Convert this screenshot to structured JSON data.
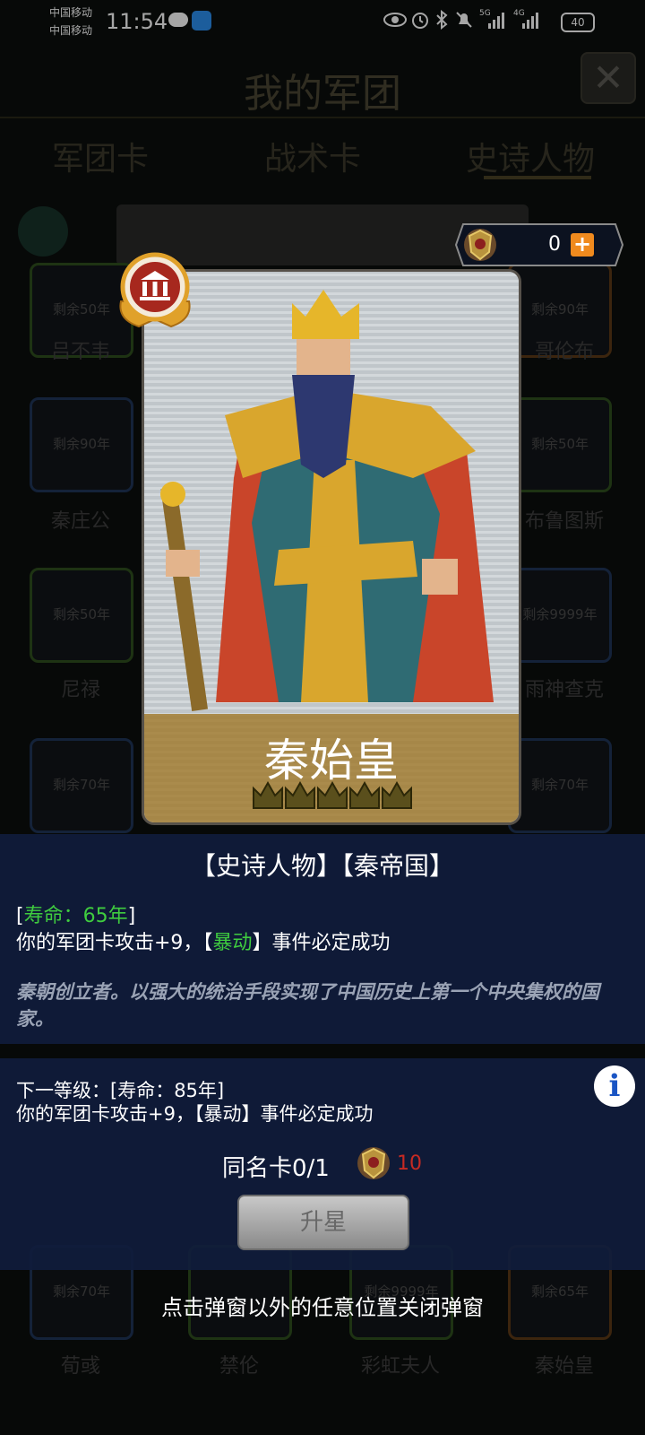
{
  "status_bar": {
    "carrier1": "中国移动",
    "carrier2": "中国移动",
    "time": "11:54",
    "signal_5g": "5G",
    "signal_4g": "4G",
    "battery": "40"
  },
  "background": {
    "title": "我的军团",
    "tabs": [
      "军团卡",
      "战术卡",
      "史诗人物"
    ],
    "cards": [
      {
        "remain": "剩余50年",
        "name": "吕不韦",
        "color": "green"
      },
      {
        "remain": "剩余90年",
        "name": "哥伦布",
        "color": "orange"
      },
      {
        "remain": "剩余90年",
        "name": "秦庄公",
        "color": "blue"
      },
      {
        "remain": "剩余50年",
        "name": "布鲁图斯",
        "color": "green"
      },
      {
        "remain": "剩余50年",
        "name": "尼禄",
        "color": "green"
      },
      {
        "remain": "剩余9999年",
        "name": "雨神查克",
        "color": "blue"
      },
      {
        "remain": "剩余70年",
        "name": "",
        "color": "blue"
      },
      {
        "remain": "剩余70年",
        "name": "",
        "color": "blue"
      },
      {
        "remain": "剩余70年",
        "name": "荀彧",
        "color": "blue"
      },
      {
        "remain": "",
        "name": "禁伦",
        "color": "green"
      },
      {
        "remain": "剩余9999年",
        "name": "彩虹夫人",
        "color": "green"
      },
      {
        "remain": "剩余65年",
        "name": "秦始皇",
        "color": "orange"
      }
    ]
  },
  "currency": {
    "value": "0",
    "plus": "+"
  },
  "hero_card": {
    "name": "秦始皇"
  },
  "info": {
    "tags": "【史诗人物】【秦帝国】",
    "life_open": "[",
    "life_text": "寿命：65年",
    "life_close": "]",
    "effect_pre": "你的军团卡攻击+9，【",
    "effect_key": "暴动",
    "effect_post": "】事件必定成功",
    "lore": "秦朝创立者。以强大的统治手段实现了中国历史上第一个中央集权的国家。"
  },
  "upgrade": {
    "next_level": "下一等级：[寿命：85年]",
    "next_effect": "你的军团卡攻击+9，【暴动】事件必定成功",
    "info_icon": "i",
    "dup_label": "同名卡0/1",
    "dup_cost": "10",
    "button_label": "升星"
  },
  "close_hint": "点击弹窗以外的任意位置关闭弹窗"
}
